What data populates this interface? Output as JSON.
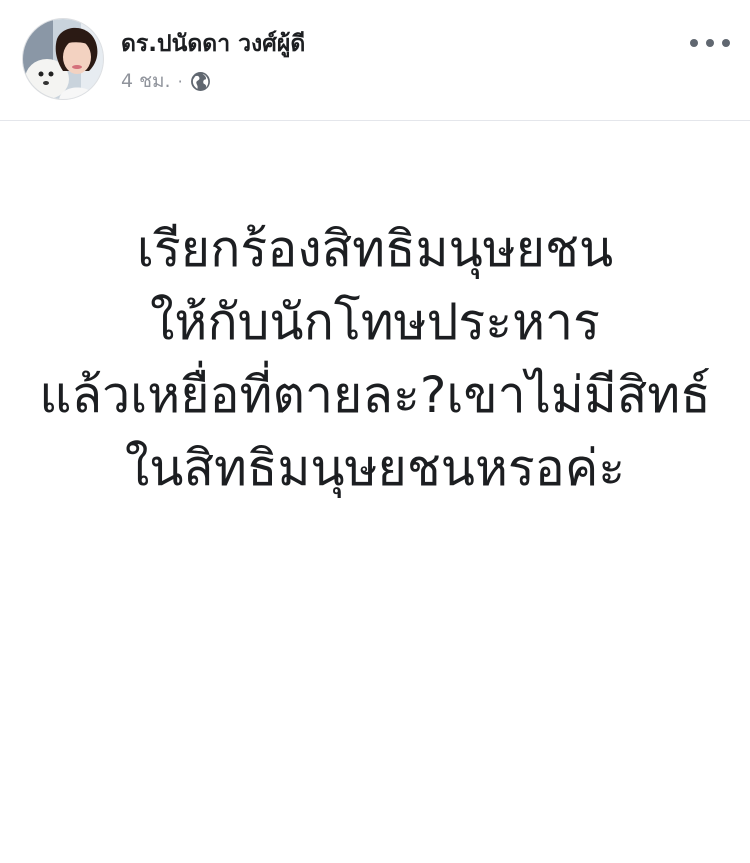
{
  "post": {
    "author_name": "ดร.ปนัดดา วงศ์ผู้ดี",
    "time": "4 ชม.",
    "separator": "·",
    "privacy_icon": "globe-icon",
    "menu_icon": "more-options-icon",
    "avatar": "profile-photo",
    "content_lines": [
      "เรียกร้องสิทธิมนุษยชน",
      "ให้กับนักโทษประหาร",
      "แล้วเหยื่อที่ตายละ?เขาไม่มีสิทธ์",
      "ในสิทธิมนุษยชนหรอค่ะ"
    ]
  },
  "colors": {
    "text_primary": "#1c1e21",
    "text_secondary": "#90949c",
    "divider": "#e4e6eb",
    "background": "#ffffff"
  }
}
